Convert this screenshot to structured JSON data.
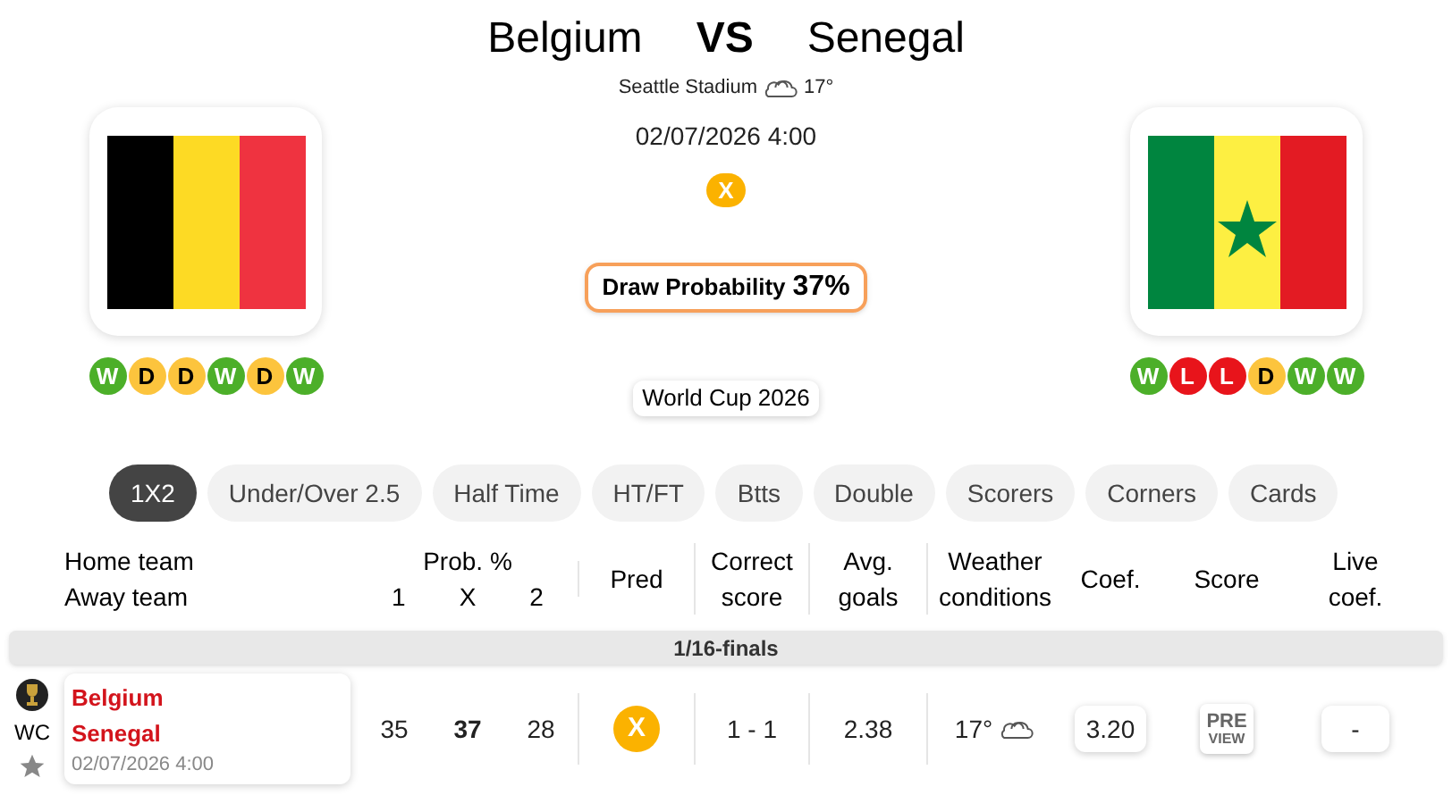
{
  "match": {
    "home": "Belgium",
    "vs": "VS",
    "away": "Senegal",
    "stadium": "Seattle Stadium",
    "temperature": "17°",
    "datetime": "02/07/2026 4:00",
    "prediction": "X",
    "draw_label": "Draw Probability",
    "draw_value": "37%",
    "competition": "World Cup 2026"
  },
  "home_form": [
    {
      "result": "W"
    },
    {
      "result": "D"
    },
    {
      "result": "D"
    },
    {
      "result": "W"
    },
    {
      "result": "D"
    },
    {
      "result": "W"
    }
  ],
  "away_form": [
    {
      "result": "W"
    },
    {
      "result": "L"
    },
    {
      "result": "L"
    },
    {
      "result": "D"
    },
    {
      "result": "W"
    },
    {
      "result": "W"
    }
  ],
  "tabs": [
    {
      "label": "1X2",
      "selected": true
    },
    {
      "label": "Under/Over 2.5",
      "selected": false
    },
    {
      "label": "Half Time",
      "selected": false
    },
    {
      "label": "HT/FT",
      "selected": false
    },
    {
      "label": "Btts",
      "selected": false
    },
    {
      "label": "Double",
      "selected": false
    },
    {
      "label": "Scorers",
      "selected": false
    },
    {
      "label": "Corners",
      "selected": false
    },
    {
      "label": "Cards",
      "selected": false
    }
  ],
  "table": {
    "columns": {
      "home_team": "Home team",
      "away_team": "Away team",
      "prob": "Prob. %",
      "p1": "1",
      "px": "X",
      "p2": "2",
      "pred": "Pred",
      "correct": "Correct score",
      "avg": "Avg. goals",
      "weather": "Weather conditions",
      "coef": "Coef.",
      "score": "Score",
      "live": "Live coef."
    },
    "group": "1/16-finals",
    "rows": [
      {
        "league": "WC",
        "favorite": false,
        "home": "Belgium",
        "away": "Senegal",
        "datetime": "02/07/2026 4:00",
        "p1": "35",
        "px": "37",
        "p2": "28",
        "pred": "X",
        "correct_score": "1 - 1",
        "avg_goals": "2.38",
        "temperature": "17°",
        "coef": "3.20",
        "score_top": "PRE",
        "score_bottom": "VIEW",
        "live_coef": "-"
      }
    ]
  }
}
